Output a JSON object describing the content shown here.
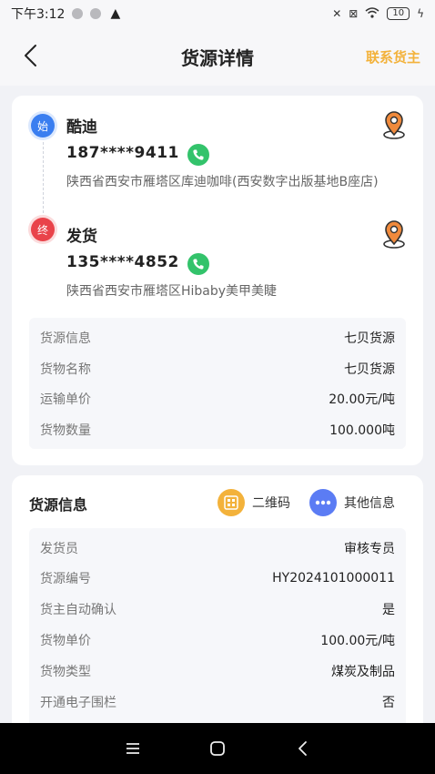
{
  "status_bar": {
    "time": "下午3:12",
    "battery": "10"
  },
  "header": {
    "title": "货源详情",
    "contact_label": "联系货主"
  },
  "route": {
    "start": {
      "badge": "始",
      "name": "酷迪",
      "phone": "187****9411",
      "address": "陕西省西安市雁塔区库迪咖啡(西安数字出版基地B座店)"
    },
    "end": {
      "badge": "终",
      "name": "发货",
      "phone": "135****4852",
      "address": "陕西省西安市雁塔区Hibaby美甲美睫"
    }
  },
  "summary_rows": [
    {
      "label": "货源信息",
      "value": "七贝货源"
    },
    {
      "label": "货物名称",
      "value": "七贝货源"
    },
    {
      "label": "运输单价",
      "value": "20.00元/吨"
    },
    {
      "label": "货物数量",
      "value": "100.000吨"
    }
  ],
  "source_section": {
    "title": "货源信息",
    "qr_label": "二维码",
    "more_label": "其他信息",
    "rows": [
      {
        "label": "发货员",
        "value": "审核专员"
      },
      {
        "label": "货源编号",
        "value": "HY2024101000011"
      },
      {
        "label": "货主自动确认",
        "value": "是"
      },
      {
        "label": "货物单价",
        "value": "100.00元/吨"
      },
      {
        "label": "货物类型",
        "value": "煤炭及制品"
      },
      {
        "label": "开通电子围栏",
        "value": "否"
      }
    ]
  },
  "icons": {
    "back": "back-arrow-icon",
    "call": "phone-call-icon",
    "location": "map-location-icon",
    "qr": "qr-code-icon",
    "more": "more-dots-icon"
  },
  "colors": {
    "accent": "#f3b23b",
    "start": "#3a7ef0",
    "end": "#e9434a",
    "call": "#33c36b",
    "more": "#5b7cf4"
  }
}
